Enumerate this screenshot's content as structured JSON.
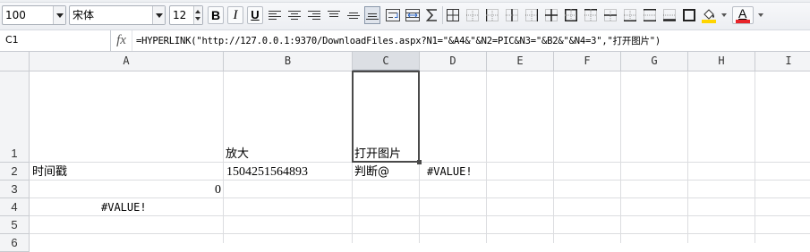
{
  "toolbar": {
    "zoom": "100",
    "font_name": "宋体",
    "font_size": "12",
    "bold_label": "B",
    "italic_label": "I",
    "underline_label": "U",
    "font_color_label": "A"
  },
  "formula_bar": {
    "cell_ref": "C1",
    "fx_label": "fx",
    "formula": "=HYPERLINK(\"http://127.0.0.1:9370/DownloadFiles.aspx?N1=\"&A4&\"&N2=PIC&N3=\"&B2&\"&N4=3\",\"打开图片\")"
  },
  "sheet": {
    "columns": [
      "A",
      "B",
      "C",
      "D",
      "E",
      "F",
      "G",
      "H",
      "I"
    ],
    "selected_column": "C",
    "rows": [
      "1",
      "2",
      "3",
      "4",
      "5",
      "6"
    ],
    "cells": {
      "B1": "放大",
      "C1": "打开图片",
      "A2": "时间戳",
      "B2": "1504251564893",
      "C2": "判断@",
      "D2": "#VALUE!",
      "A3": "0",
      "A4": "#VALUE!"
    }
  },
  "colors": {
    "toolbar_bg": "#eceef2",
    "header_bg": "#f3f4f6",
    "gridline": "#dcdde0",
    "selection_border": "#4a4a4a",
    "highlight_yellow": "#ffd500",
    "font_color_red": "#e8242a"
  }
}
